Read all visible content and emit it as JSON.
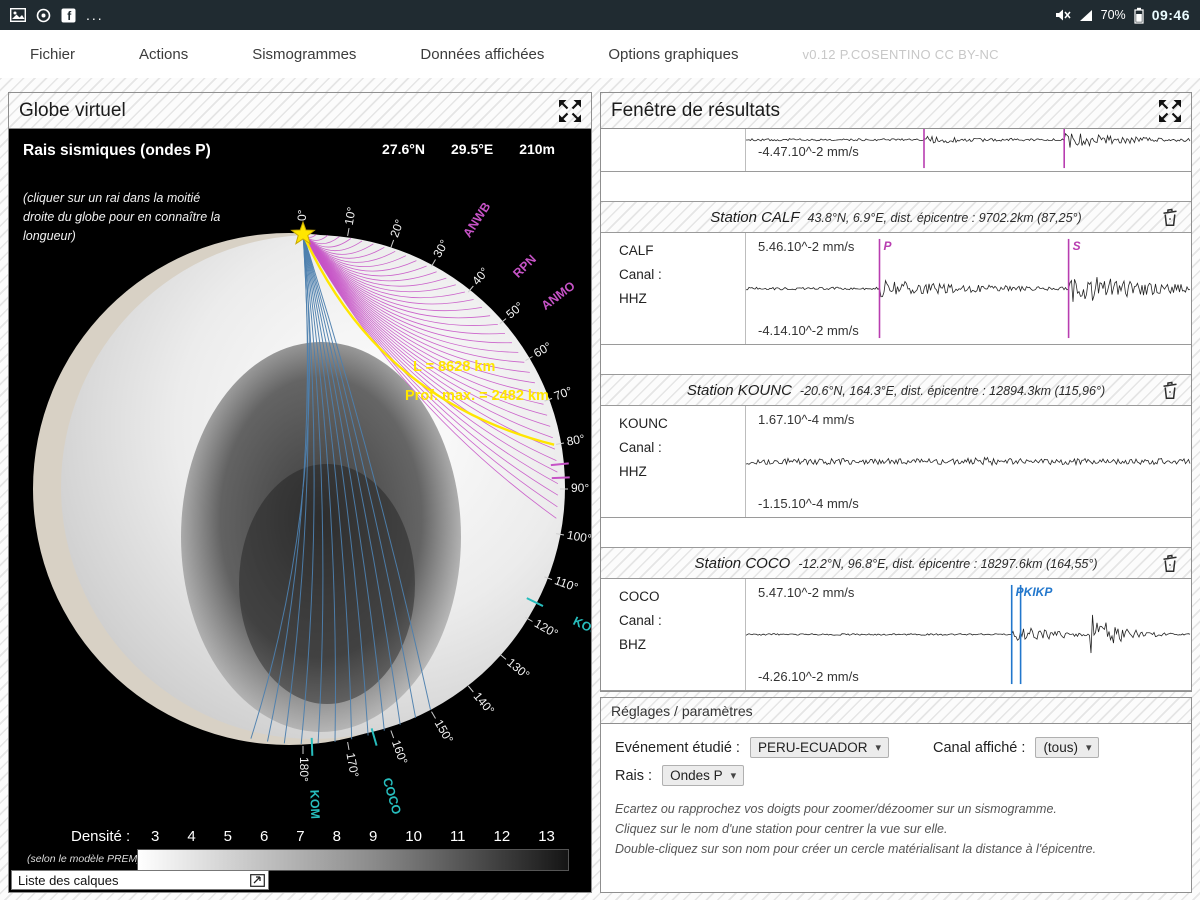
{
  "colors": {
    "accent_magenta": "#b83db0",
    "accent_blue": "#2277cc",
    "ray_p": "#c653c6",
    "ray_core": "#4d7fae",
    "ray_highlight": "#ffe600",
    "station_cyan": "#27bdbd"
  },
  "status_bar": {
    "time": "09:46",
    "battery_percent": "70%"
  },
  "menu": {
    "items": [
      "Fichier",
      "Actions",
      "Sismogrammes",
      "Données affichées",
      "Options graphiques"
    ],
    "version": "v0.12 P.COSENTINO CC BY-NC"
  },
  "globe": {
    "title": "Globe virtuel",
    "heading": "Rais sismiques (ondes P)",
    "coords": [
      "27.6°N",
      "29.5°E",
      "210m"
    ],
    "note": "(cliquer sur un rai dans la moitié droite du globe pour en connaître la longueur)",
    "ray_length": "L = 8628 km",
    "ray_depth": "Prof. max. = 2482 km",
    "density_label": "Densité :",
    "density_values": [
      "3",
      "4",
      "5",
      "6",
      "7",
      "8",
      "9",
      "10",
      "11",
      "12",
      "13"
    ],
    "density_note": "(selon le modèle PREM)",
    "layers_button": "Liste des calques",
    "angle_labels": [
      "0°",
      "10°",
      "20°",
      "30°",
      "40°",
      "50°",
      "60°",
      "70°",
      "80°",
      "90°",
      "100°",
      "110°",
      "120°",
      "130°",
      "140°",
      "150°",
      "160°",
      "170°",
      "180°"
    ],
    "stations": [
      {
        "name": "ANWB",
        "angle": 33,
        "color": "#c653c6"
      },
      {
        "name": "RPN",
        "angle": 45,
        "color": "#c653c6"
      },
      {
        "name": "ANMO",
        "angle": 53,
        "color": "#c653c6"
      },
      {
        "name": "KOUNC",
        "angle": 116,
        "color": "#27bdbd"
      },
      {
        "name": "COCO",
        "angle": 164,
        "color": "#27bdbd"
      },
      {
        "name": "KOM",
        "angle": 178,
        "color": "#27bdbd"
      }
    ],
    "arrival_ticks": [
      {
        "angle": 84.5,
        "color": "#c653c6"
      },
      {
        "angle": 87.5,
        "color": "#c653c6"
      },
      {
        "angle": 116,
        "color": "#27bdbd"
      },
      {
        "angle": 164,
        "color": "#27bdbd"
      },
      {
        "angle": 178,
        "color": "#27bdbd"
      }
    ]
  },
  "results": {
    "title": "Fenêtre de résultats",
    "partial": {
      "min": "-4.47.10^-2 mm/s",
      "markers": [
        {
          "label": "",
          "pos": 0.4,
          "color": "#b83db0"
        },
        {
          "label": "",
          "pos": 0.715,
          "color": "#b83db0"
        }
      ],
      "wave": {
        "seed": 7,
        "segments": [
          {
            "at": 0,
            "amp": 1.1,
            "k": 0
          },
          {
            "at": 0.4,
            "amp": 4,
            "k": 5
          },
          {
            "at": 0.715,
            "amp": 9,
            "k": 6
          }
        ]
      }
    },
    "cards": [
      {
        "station": "Station CALF",
        "info": "43.8°N, 6.9°E, dist. épicentre : 9702.2km (87,25°)",
        "code": "CALF",
        "channel_label": "Canal :",
        "channel": "HHZ",
        "max": "5.46.10^-2 mm/s",
        "min": "-4.14.10^-2 mm/s",
        "markers": [
          {
            "label": "P",
            "pos": 0.3,
            "color": "#b83db0"
          },
          {
            "label": "S",
            "pos": 0.725,
            "color": "#b83db0"
          }
        ],
        "wave": {
          "seed": 11,
          "segments": [
            {
              "at": 0,
              "amp": 1.4,
              "k": 0
            },
            {
              "at": 0.3,
              "amp": 9,
              "k": 4
            },
            {
              "at": 0.725,
              "amp": 16,
              "k": 5
            }
          ]
        }
      },
      {
        "station": "Station KOUNC",
        "info": "-20.6°N, 164.3°E, dist. épicentre : 12894.3km (115,96°)",
        "code": "KOUNC",
        "channel_label": "Canal :",
        "channel": "HHZ",
        "max": "1.67.10^-4 mm/s",
        "min": "-1.15.10^-4 mm/s",
        "markers": [],
        "wave": {
          "seed": 23,
          "segments": [
            {
              "at": 0,
              "amp": 3.2,
              "k": 0
            },
            {
              "at": 0.5,
              "amp": 5,
              "k": 5
            }
          ]
        }
      },
      {
        "station": "Station COCO",
        "info": "-12.2°N, 96.8°E, dist. épicentre : 18297.6km (164,55°)",
        "code": "COCO",
        "channel_label": "Canal :",
        "channel": "BHZ",
        "max": "5.47.10^-2 mm/s",
        "min": "-4.26.10^-2 mm/s",
        "markers": [
          {
            "label": "PKIKP",
            "pos": 0.597,
            "color": "#2277cc"
          },
          {
            "label": "",
            "pos": 0.617,
            "color": "#2277cc"
          }
        ],
        "wave": {
          "seed": 37,
          "segments": [
            {
              "at": 0,
              "amp": 0.8,
              "k": 0
            },
            {
              "at": 0.597,
              "amp": 9,
              "k": 8
            },
            {
              "at": 0.775,
              "amp": 24,
              "k": 16
            }
          ]
        }
      }
    ]
  },
  "settings": {
    "title": "Réglages / paramètres",
    "event_label": "Evénement étudié :",
    "event_value": "PERU-ECUADOR",
    "channel_label": "Canal affiché :",
    "channel_value": "(tous)",
    "rays_label": "Rais :",
    "rays_value": "Ondes P",
    "instructions": [
      "Ecartez ou rapprochez vos doigts pour zoomer/dézoomer sur un sismogramme.",
      "Cliquez sur le nom d'une station pour centrer la vue sur elle.",
      "Double-cliquez sur son nom pour créer un cercle matérialisant la distance à l'épicentre."
    ]
  }
}
